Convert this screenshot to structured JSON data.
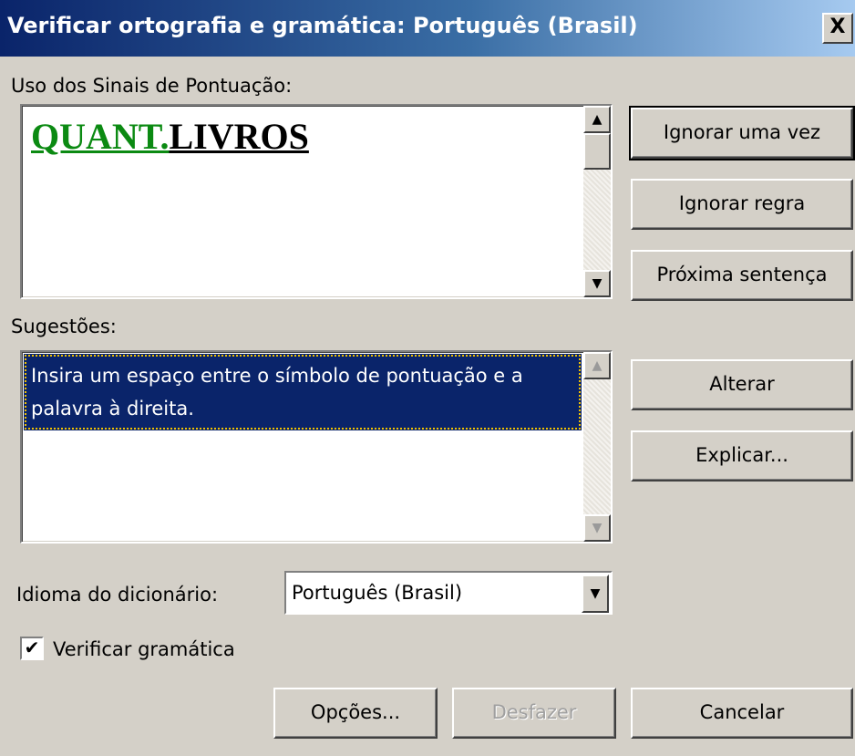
{
  "window": {
    "title": "Verificar ortografia e gramática: Português (Brasil)",
    "close_glyph": "X"
  },
  "sentence": {
    "label": "Uso dos Sinais de Pontuação:",
    "error_part": "QUANT.",
    "rest_part": "LIVROS",
    "error_color": "#0b8a12"
  },
  "suggestions": {
    "label": "Sugestões:",
    "items": [
      "Insira um espaço entre o símbolo de pontuação e a palavra à direita."
    ]
  },
  "dictionary": {
    "label": "Idioma do dicionário:",
    "selected": "Português (Brasil)"
  },
  "grammar_check": {
    "label": "Verificar gramática",
    "checked": true
  },
  "buttons": {
    "ignore_once": "Ignorar uma vez",
    "ignore_rule": "Ignorar regra",
    "next_sentence": "Próxima sentença",
    "change": "Alterar",
    "explain": "Explicar...",
    "options": "Opções...",
    "undo": "Desfazer",
    "cancel": "Cancelar"
  },
  "colors": {
    "dialog_bg": "#d4d0c8",
    "title_bar": "#0a246a",
    "selection": "#0a246a"
  },
  "icons": {
    "scroll_up": "▲",
    "scroll_down": "▼",
    "dropdown": "▼",
    "check": "✔"
  }
}
